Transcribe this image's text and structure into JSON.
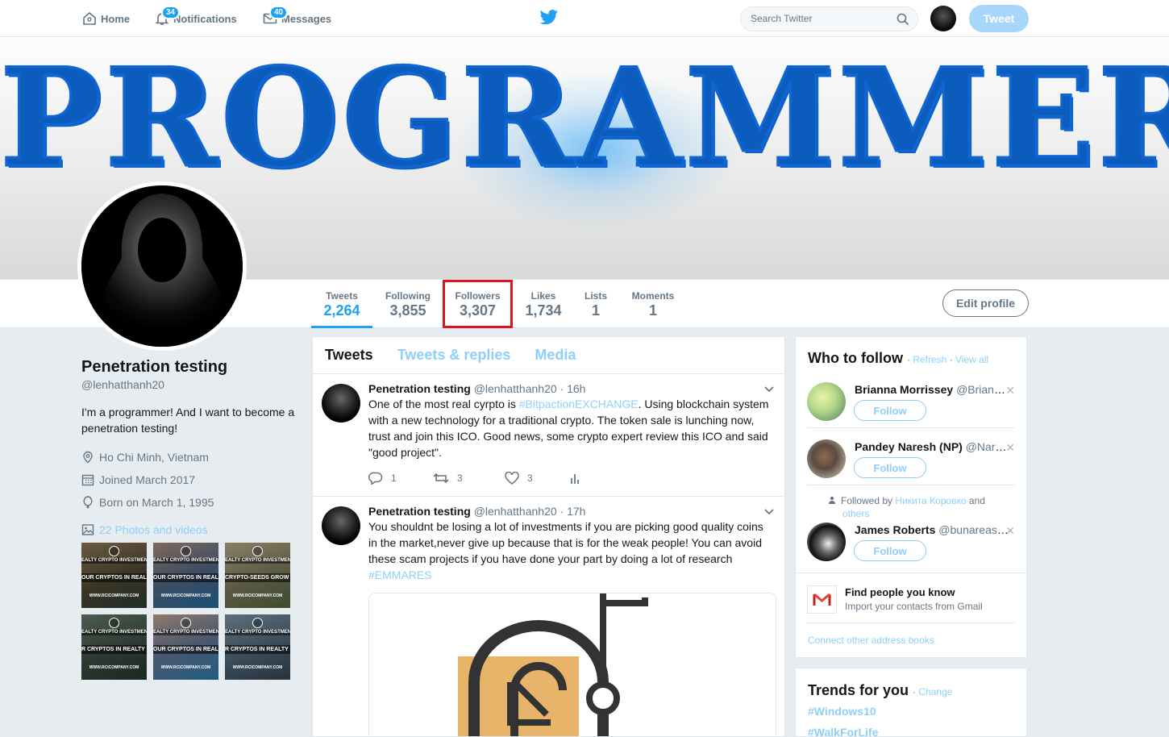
{
  "nav": {
    "home": "Home",
    "notifications": "Notifications",
    "notifications_badge": "34",
    "messages": "Messages",
    "messages_badge": "40",
    "search_placeholder": "Search Twitter",
    "tweet_button": "Tweet"
  },
  "banner": {
    "text": "PROGRAMMER"
  },
  "profile_nav": {
    "tweets_label": "Tweets",
    "tweets_value": "2,264",
    "following_label": "Following",
    "following_value": "3,855",
    "followers_label": "Followers",
    "followers_value": "3,307",
    "likes_label": "Likes",
    "likes_value": "1,734",
    "lists_label": "Lists",
    "lists_value": "1",
    "moments_label": "Moments",
    "moments_value": "1",
    "edit_profile": "Edit profile"
  },
  "profile": {
    "name": "Penetration testing",
    "handle": "@lenhatthanh20",
    "bio": "I'm a programmer! And I want to become a penetration testing!",
    "location": "Ho Chi Minh, Vietnam",
    "joined": "Joined March 2017",
    "born": "Born on March 1, 1995",
    "photos_link": "22 Photos and videos",
    "thumbs": [
      {
        "top": "EALTY CRYPTO INVESTMENT H",
        "mid": "OUR CRYPTOS IN REAL E",
        "bottom": "WWW.RCICOMPANY.COM"
      },
      {
        "top": "EALTY CRYPTO INVESTMENT H",
        "mid": "OUR CRYPTOS IN REAL E",
        "bottom": "WWW.RCICOMPANY.COM"
      },
      {
        "top": "EALTY CRYPTO INVESTMENT H",
        "mid": "CRYPTO-SEEDS GROW ON",
        "bottom": "WWW.RCICOMPANY.COM"
      },
      {
        "top": "EALTY CRYPTO INVESTMENT H",
        "mid": "R CRYPTOS IN REALTY DE",
        "bottom": "WWW.RCICOMPANY.COM"
      },
      {
        "top": "EALTY CRYPTO INVESTMENT H",
        "mid": "OUR CRYPTOS IN REAL E",
        "bottom": "WWW.RCICOMPANY.COM"
      },
      {
        "top": "EALTY CRYPTO INVESTMENT H",
        "mid": "R CRYPTOS IN REALTY DE",
        "bottom": "WWW.RCICOMPANY.COM"
      }
    ]
  },
  "timeline": {
    "tabs": [
      "Tweets",
      "Tweets & replies",
      "Media"
    ],
    "tweets": [
      {
        "name": "Penetration testing",
        "handle": "@lenhatthanh20",
        "time": "· 16h",
        "text_before": "One of the most real cyrpto is ",
        "tag": "#BitpactionEXCHANGE",
        "text_after": ". Using blockchain system with a new technology for a traditional crypto. The token sale is lunching now, trust and join this ICO. Good news, some crypto expert review this ICO and said \"good project\".",
        "replies": "1",
        "retweets": "3",
        "likes": "3"
      },
      {
        "name": "Penetration testing",
        "handle": "@lenhatthanh20",
        "time": "· 17h",
        "text": "You shouldnt be losing a lot of investments if you are picking good quality coins in the market,never give up because that is for the weak people! You can avoid these scam projects if you have done your part by doing a lot of research",
        "tag": "#EMMARES"
      }
    ]
  },
  "who_to_follow": {
    "title": "Who to follow",
    "refresh": "Refresh",
    "view_all": "View all",
    "follow_label": "Follow",
    "suggestions": [
      {
        "name": "Brianna Morrissey",
        "handle": "@BriannaMorrissey"
      },
      {
        "name": "Pandey Naresh (NP)",
        "handle": "@NareshPandey"
      },
      {
        "name": "James Roberts",
        "handle": "@bunareastrada"
      }
    ],
    "followed_by_prefix": "Followed by",
    "followed_by_name": "Никита Коровко",
    "followed_by_suffix": "and",
    "followed_by_others": "others",
    "find_title": "Find people you know",
    "find_sub": "Import your contacts from Gmail",
    "connect": "Connect other address books"
  },
  "trends": {
    "title": "Trends for you",
    "change": "Change",
    "items": [
      "#Windows10",
      "#WalkForLife"
    ]
  },
  "colors": {
    "accent": "#1da1f2",
    "highlight_box": "#e0141e",
    "link_light": "#8ed0f9"
  }
}
